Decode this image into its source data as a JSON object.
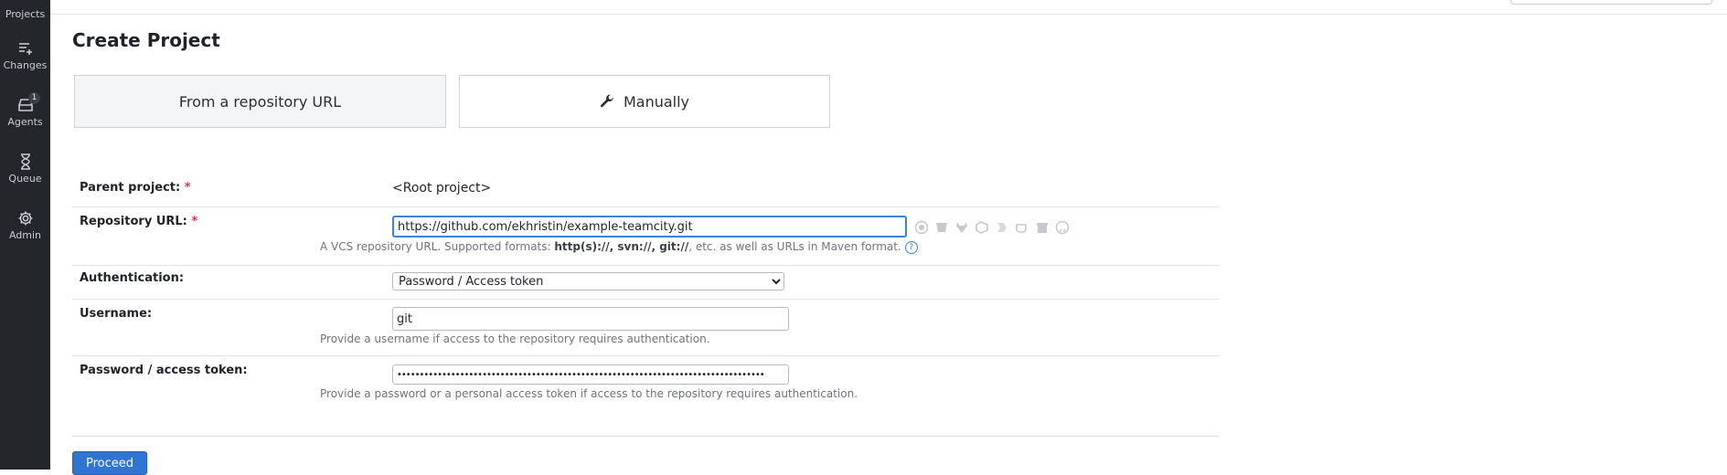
{
  "sidebar": {
    "items": [
      {
        "label": "Projects",
        "icon": "projects-icon"
      },
      {
        "label": "Changes",
        "icon": "changes-icon"
      },
      {
        "label": "Agents",
        "icon": "agents-icon",
        "badge": "1"
      },
      {
        "label": "Queue",
        "icon": "hourglass-icon"
      },
      {
        "label": "Admin",
        "icon": "gear-icon"
      }
    ]
  },
  "header": {
    "title": "Create Project"
  },
  "tabs": {
    "from_url": "From a repository URL",
    "manually": "Manually"
  },
  "form": {
    "parent_project": {
      "label": "Parent project:",
      "required": "*",
      "value": "<Root project>"
    },
    "repository_url": {
      "label": "Repository URL:",
      "required": "*",
      "value": "https://github.com/ekhristin/example-teamcity.git",
      "hint_prefix": "A VCS repository URL. Supported formats: ",
      "hint_formats": "http(s)://, svn://, git://",
      "hint_suffix": ", etc. as well as URLs in Maven format.",
      "help": "?"
    },
    "authentication": {
      "label": "Authentication:",
      "selected": "Password / Access token"
    },
    "username": {
      "label": "Username:",
      "value": "git",
      "hint": "Provide a username if access to the repository requires authentication."
    },
    "password": {
      "label": "Password / access token:",
      "value": "••••••••••••••••••••••••••••••••••••••••••••••••••••••••••••••••••••••••••••••••••",
      "hint": "Provide a password or a personal access token if access to the repository requires authentication."
    }
  },
  "actions": {
    "proceed": "Proceed"
  },
  "colors": {
    "sidebar_bg": "#23262b",
    "primary": "#2f74d0",
    "required": "#e0334a",
    "focus": "#3b82d6"
  }
}
